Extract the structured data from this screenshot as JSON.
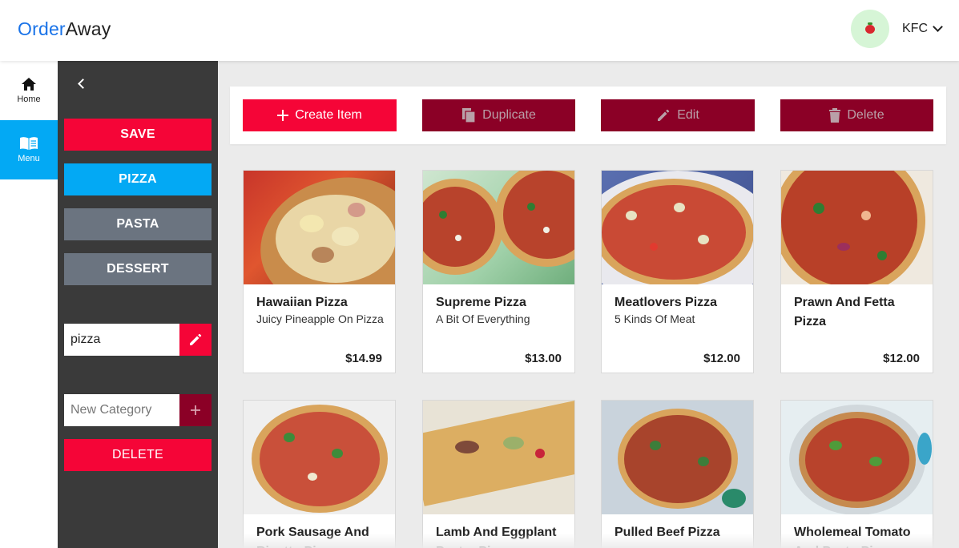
{
  "app": {
    "logo_part1": "Order",
    "logo_part2": "Away"
  },
  "account": {
    "name": "KFC",
    "avatar_icon": "tomato-icon"
  },
  "nav": [
    {
      "label": "Home",
      "icon": "home-icon",
      "active": false
    },
    {
      "label": "Menu",
      "icon": "menu-book-icon",
      "active": true
    }
  ],
  "panel": {
    "save_label": "SAVE",
    "categories": [
      "PIZZA",
      "PASTA",
      "DESSERT"
    ],
    "category_name_value": "pizza",
    "new_category_placeholder": "New Category",
    "delete_label": "DELETE"
  },
  "toolbar": {
    "create_label": "Create Item",
    "duplicate_label": "Duplicate",
    "edit_label": "Edit",
    "delete_label": "Delete"
  },
  "items": [
    {
      "name": "Hawaiian Pizza",
      "description": "Juicy Pineapple On Pizza",
      "price": "$14.99"
    },
    {
      "name": "Supreme Pizza",
      "description": "A Bit Of Everything",
      "price": "$13.00"
    },
    {
      "name": "Meatlovers Pizza",
      "description": "5 Kinds Of Meat",
      "price": "$12.00"
    },
    {
      "name": "Prawn And Fetta Pizza",
      "description": "",
      "price": "$12.00"
    },
    {
      "name": "Pork Sausage And Risotto Pizza",
      "description": "",
      "price": ""
    },
    {
      "name": "Lamb And Eggplant Pastry Pizza",
      "description": "",
      "price": ""
    },
    {
      "name": "Pulled Beef Pizza",
      "description": "",
      "price": ""
    },
    {
      "name": "Wholemeal Tomato And Pesto Pizza",
      "description": "",
      "price": ""
    }
  ],
  "colors": {
    "primary": "#f50537",
    "primary_dark": "#8b0026",
    "accent_blue": "#03a9f4",
    "category_grey": "#6b7480",
    "panel_bg": "#3a3a3a"
  }
}
